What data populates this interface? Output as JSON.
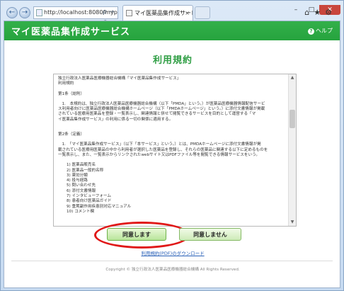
{
  "browser": {
    "address": "http://localhost:8080/mype",
    "address_tools": "ρ → C",
    "tab_title": "マイ医薬品集作成サービ...",
    "tab_close": "×",
    "icons": "⌂★⚙",
    "win_min": "–",
    "win_max": "□",
    "win_close": "✕"
  },
  "header": {
    "title": "マイ医薬品集作成サービス",
    "help_label": "ヘルプ",
    "help_icon_glyph": "?"
  },
  "page_heading": "利用規約",
  "terms": {
    "lines": [
      "独立行政法人医薬品医療機器総合機構「マイ医薬品集作成サービス」",
      "利用規約",
      "",
      "第1条（総則）",
      "",
      "　1.　本規約は、独立行政法人医薬品医療機器総合機構（以下「PMDA」という。）が医薬品医療機器情報配信サービ",
      "ス利用者向けに医薬品医療機器総合機構ホームページ（以下「PMDAホームページ」という。）に添付文書情報が掲載",
      "されている医療用医薬品を登録・一覧表示し、関連情報と併せて閲覧できるサービスを目的として運営する「マ",
      "イ医薬品集作成サービス」の利用に係る一切の関係に適用する。",
      "",
      "",
      "第2条（定義）",
      "",
      "　1.　「マイ医薬品集作成サービス」（以下「本サービス」という。）とは、PMDAホームページに添付文書情報が掲",
      "載されている医療用医薬品の中から利用者が選択した医薬品を登録し、それらの医薬品に関連する以下に定めるものを",
      "一覧表示し、また、一覧表示からリンクされたwebサイト又はPDFファイル等を閲覧できる情報サービスをいう。",
      ""
    ],
    "list": [
      "1) 医薬品販売名",
      "2) 医薬品一般的名称",
      "3) 薬効分類",
      "4) 投与経路",
      "5) 問い合わせ先",
      "6) 添付文書情報",
      "7) インタビューフォーム",
      "8) 患者向け医薬品ガイド",
      "9) 重篤副作用疾患別対応マニュアル",
      "10) コメント欄"
    ]
  },
  "buttons": {
    "agree": "同意します",
    "disagree": "同意しません"
  },
  "pdf_link": "利用規約(PDF)のダウンロード",
  "footer": "Copyright © 独立行政法人医薬品医療機器総合機構 All Rights Reserved.",
  "colors": {
    "header_green": "#2aa640",
    "heading_green": "#2f9e44",
    "highlight_red": "#e01818",
    "link_blue": "#2b62b8"
  }
}
